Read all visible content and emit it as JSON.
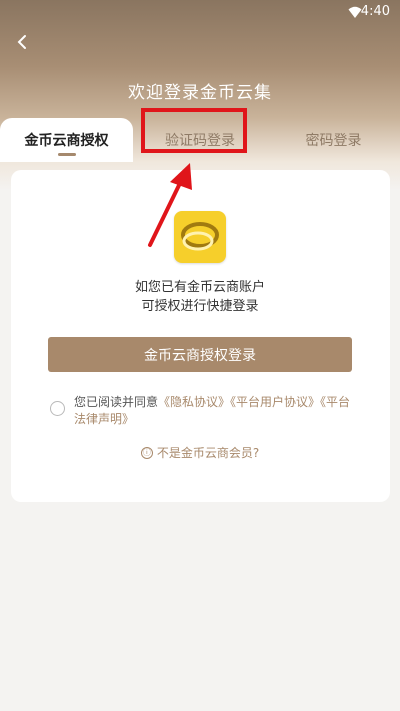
{
  "status_bar": {
    "time": "4:40",
    "wifi_icon": "wifi-icon"
  },
  "header": {
    "title": "欢迎登录金币云集",
    "back_icon": "back-chevron-icon"
  },
  "tabs": [
    {
      "label": "金币云商授权",
      "active": true
    },
    {
      "label": "验证码登录",
      "active": false
    },
    {
      "label": "密码登录",
      "active": false
    }
  ],
  "card": {
    "logo_icon": "gold-rings-logo",
    "description_line1": "如您已有金币云商账户",
    "description_line2": "可授权进行快捷登录",
    "auth_button_label": "金币云商授权登录",
    "agreement": {
      "prefix": "您已阅读并同意",
      "privacy": "《隐私协议》",
      "user": "《平台用户协议》",
      "legal": "《平台法律声明》"
    },
    "not_member": "不是金币云商会员?"
  },
  "colors": {
    "accent": "#a8896b",
    "highlight": "#e0151a",
    "logo_bg": "#f6cf2b"
  }
}
